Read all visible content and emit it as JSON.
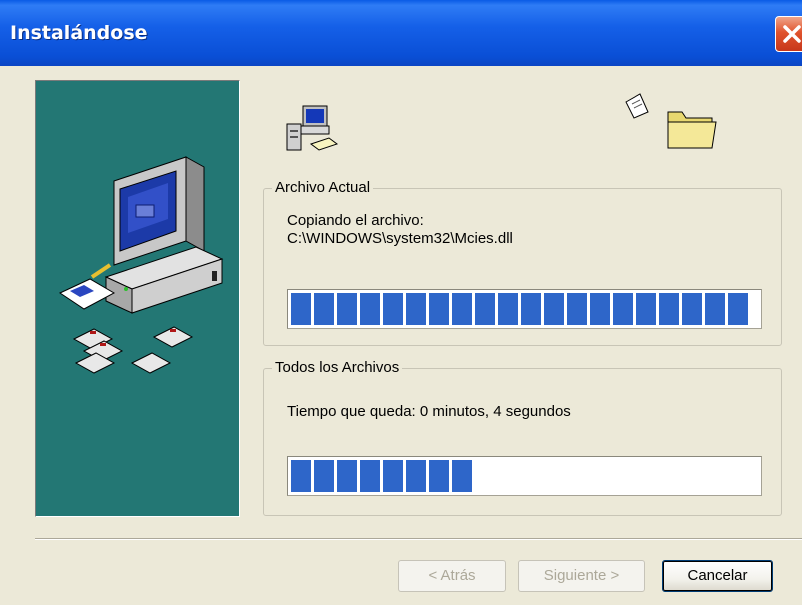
{
  "window": {
    "title": "Instalándose",
    "close_icon": "close-icon"
  },
  "icons": {
    "header_left": "computer-setup-icon",
    "header_right": "file-to-folder-icon",
    "side_illustration": "computer-disks-illustration"
  },
  "current_file": {
    "group_label": "Archivo Actual",
    "status_line": "Copiando el archivo:",
    "path": "C:\\WINDOWS\\system32\\Mcies.dll",
    "progress": 1.0
  },
  "all_files": {
    "group_label": "Todos los Archivos",
    "time_remaining": "Tiempo que queda: 0 minutos, 4 segundos",
    "progress": 0.4
  },
  "buttons": {
    "back": "< Atrás",
    "next": "Siguiente >",
    "cancel": "Cancelar"
  },
  "colors": {
    "title_bar": "#0a4fd6",
    "side_panel": "#237774",
    "progress_block": "#2e66c9",
    "window_bg": "#ece9d8"
  }
}
